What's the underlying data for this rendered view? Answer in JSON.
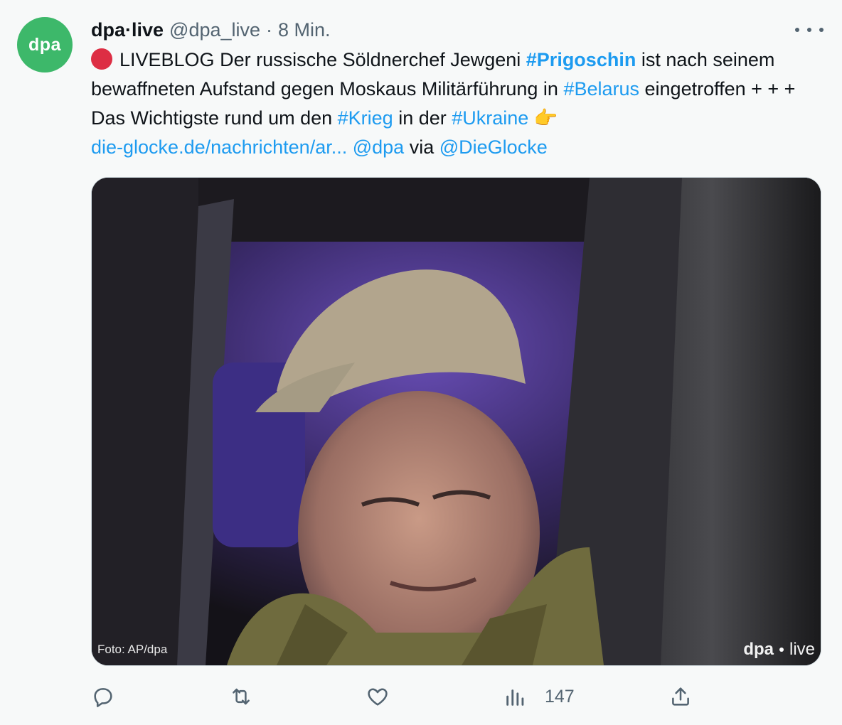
{
  "author": {
    "avatar_text": "dpa",
    "display_name": "dpa·live",
    "handle": "@dpa_live",
    "separator": "·",
    "time": "8 Min."
  },
  "tweet": {
    "segments": [
      {
        "text": "LIVEBLOG Der russische Söldnerchef Jewgeni ",
        "type": "text"
      },
      {
        "text": "#Prigoschin",
        "type": "hashtag-strong"
      },
      {
        "text": " ist nach seinem bewaffneten Aufstand gegen Moskaus Militärführung in ",
        "type": "text"
      },
      {
        "text": "#Belarus",
        "type": "hashtag"
      },
      {
        "text": " eingetroffen + + + Das Wichtigste rund um den ",
        "type": "text"
      },
      {
        "text": "#Krieg",
        "type": "hashtag"
      },
      {
        "text": " in der ",
        "type": "text"
      },
      {
        "text": "#Ukraine",
        "type": "hashtag"
      },
      {
        "text": "die-glocke.de/nachrichten/ar...",
        "type": "link"
      },
      {
        "text": "@dpa",
        "type": "mention"
      },
      {
        "text": "via",
        "type": "text"
      },
      {
        "text": "@DieGlocke",
        "type": "mention"
      }
    ],
    "emoji_red_circle": "red-circle",
    "emoji_pointing": "👉"
  },
  "media": {
    "photo_credit": "Foto: AP/dpa",
    "watermark_left": "dpa",
    "watermark_right": "live"
  },
  "actions": {
    "views_count": "147"
  },
  "colors": {
    "link": "#1d9bf0",
    "avatar_bg": "#3db86a",
    "muted": "#536471"
  }
}
